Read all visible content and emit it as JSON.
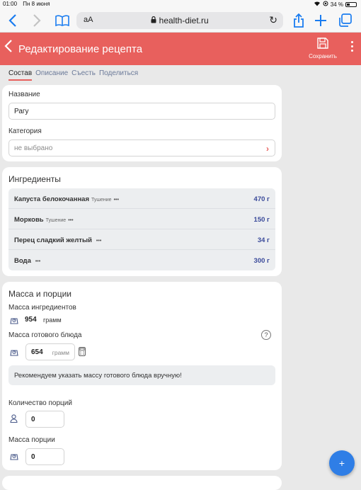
{
  "status": {
    "time": "01:00",
    "date": "Пн 8 июня",
    "battery": "34 %",
    "battery_level": 0.34
  },
  "browser": {
    "text_size": "аА",
    "url": "health-diet.ru"
  },
  "header": {
    "title": "Редактирование рецепта",
    "save_label": "Сохранить"
  },
  "tabs": [
    {
      "label": "Состав",
      "active": true
    },
    {
      "label": "Описание"
    },
    {
      "label": "Съесть"
    },
    {
      "label": "Поделиться"
    }
  ],
  "basic": {
    "name_label": "Название",
    "name_value": "Рагу",
    "category_label": "Категория",
    "category_value": "не выбрано"
  },
  "ingredients": {
    "title": "Ингредиенты",
    "items": [
      {
        "name": "Капуста белокочанная",
        "method": "Тушение",
        "dots": "•••",
        "weight": "470 г"
      },
      {
        "name": "Морковь",
        "method": "Тушение",
        "dots": "•••",
        "weight": "150 г"
      },
      {
        "name": "Перец сладкий желтый",
        "method": "",
        "dots": "•••",
        "weight": "34 г"
      },
      {
        "name": "Вода",
        "method": "",
        "dots": "•••",
        "weight": "300 г"
      }
    ]
  },
  "mass": {
    "title": "Масса и порции",
    "ingredients_mass_label": "Масса ингредиентов",
    "ingredients_mass_value": "954",
    "unit": "грамм",
    "dish_mass_label": "Масса готового блюда",
    "help": "?",
    "dish_mass_value": "654",
    "dish_mass_unit": "грамм",
    "hint": "Рекомендуем указать массу готового блюда вручную!",
    "portions_label": "Количество порций",
    "portions_value": "0",
    "portion_mass_label": "Масса порции",
    "portion_mass_value": "0"
  },
  "fab_label": "+",
  "colors": {
    "accent": "#e8605d",
    "link": "#1a7cf0",
    "weight": "#3a4a9a",
    "fab": "#2f7ee6"
  }
}
